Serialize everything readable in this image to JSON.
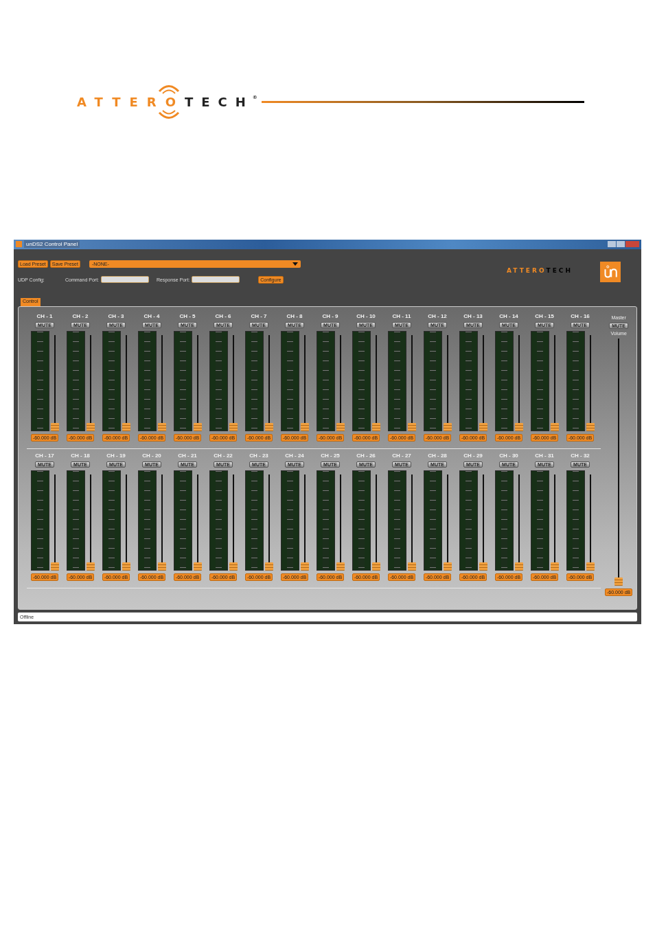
{
  "brand": {
    "first": "ATTERO",
    "second": "TECH",
    "mark": "®"
  },
  "window": {
    "title": "unDS2 Control Panel"
  },
  "toolbar": {
    "buttons": [
      "Load Preset",
      "Save Preset"
    ],
    "preset": "-NONE-"
  },
  "udp": {
    "label": "UDP Config:",
    "command_label": "Command Port:",
    "response_label": "Response Port:",
    "button": "Configure"
  },
  "header_logo": {
    "first": "ATTERO",
    "second": "TECH"
  },
  "tabs": [
    {
      "label": "Control",
      "selected": true
    }
  ],
  "channels": [
    {
      "name": "CH - 1",
      "mute": "MUTE",
      "muted": false,
      "level": 0,
      "reading": "-60.000 dB"
    },
    {
      "name": "CH - 2",
      "mute": "MUTE",
      "muted": false,
      "level": 0,
      "reading": "-60.000 dB"
    },
    {
      "name": "CH - 3",
      "mute": "MUTE",
      "muted": false,
      "level": 0,
      "reading": "-60.000 dB"
    },
    {
      "name": "CH - 4",
      "mute": "MUTE",
      "muted": false,
      "level": 0,
      "reading": "-60.000 dB"
    },
    {
      "name": "CH - 5",
      "mute": "MUTE",
      "muted": false,
      "level": 0,
      "reading": "-60.000 dB"
    },
    {
      "name": "CH - 6",
      "mute": "MUTE",
      "muted": false,
      "level": 0,
      "reading": "-60.000 dB"
    },
    {
      "name": "CH - 7",
      "mute": "MUTE",
      "muted": false,
      "level": 0,
      "reading": "-60.000 dB"
    },
    {
      "name": "CH - 8",
      "mute": "MUTE",
      "muted": false,
      "level": 0,
      "reading": "-60.000 dB"
    },
    {
      "name": "CH - 9",
      "mute": "MUTE",
      "muted": false,
      "level": 0,
      "reading": "-60.000 dB"
    },
    {
      "name": "CH - 10",
      "mute": "MUTE",
      "muted": false,
      "level": 0,
      "reading": "-60.000 dB"
    },
    {
      "name": "CH - 11",
      "mute": "MUTE",
      "muted": false,
      "level": 0,
      "reading": "-60.000 dB"
    },
    {
      "name": "CH - 12",
      "mute": "MUTE",
      "muted": false,
      "level": 0,
      "reading": "-60.000 dB"
    },
    {
      "name": "CH - 13",
      "mute": "MUTE",
      "muted": false,
      "level": 0,
      "reading": "-60.000 dB"
    },
    {
      "name": "CH - 14",
      "mute": "MUTE",
      "muted": false,
      "level": 0,
      "reading": "-60.000 dB"
    },
    {
      "name": "CH - 15",
      "mute": "MUTE",
      "muted": false,
      "level": 0,
      "reading": "-60.000 dB"
    },
    {
      "name": "CH - 16",
      "mute": "MUTE",
      "muted": false,
      "level": 0,
      "reading": "-60.000 dB"
    },
    {
      "name": "CH - 17",
      "mute": "MUTE",
      "muted": false,
      "level": 0,
      "reading": "-60.000 dB"
    },
    {
      "name": "CH - 18",
      "mute": "MUTE",
      "muted": false,
      "level": 0,
      "reading": "-60.000 dB"
    },
    {
      "name": "CH - 19",
      "mute": "MUTE",
      "muted": false,
      "level": 0,
      "reading": "-60.000 dB"
    },
    {
      "name": "CH - 20",
      "mute": "MUTE",
      "muted": false,
      "level": 0,
      "reading": "-60.000 dB"
    },
    {
      "name": "CH - 21",
      "mute": "MUTE",
      "muted": false,
      "level": 0,
      "reading": "-60.000 dB"
    },
    {
      "name": "CH - 22",
      "mute": "MUTE",
      "muted": false,
      "level": 0,
      "reading": "-60.000 dB"
    },
    {
      "name": "CH - 23",
      "mute": "MUTE",
      "muted": false,
      "level": 0,
      "reading": "-60.000 dB"
    },
    {
      "name": "CH - 24",
      "mute": "MUTE",
      "muted": false,
      "level": 0,
      "reading": "-60.000 dB"
    },
    {
      "name": "CH - 25",
      "mute": "MUTE",
      "muted": false,
      "level": 0,
      "reading": "-60.000 dB"
    },
    {
      "name": "CH - 26",
      "mute": "MUTE",
      "muted": false,
      "level": 0,
      "reading": "-60.000 dB"
    },
    {
      "name": "CH - 27",
      "mute": "MUTE",
      "muted": false,
      "level": 0,
      "reading": "-60.000 dB"
    },
    {
      "name": "CH - 28",
      "mute": "MUTE",
      "muted": false,
      "level": 0,
      "reading": "-60.000 dB"
    },
    {
      "name": "CH - 29",
      "mute": "MUTE",
      "muted": false,
      "level": 0,
      "reading": "-60.000 dB"
    },
    {
      "name": "CH - 30",
      "mute": "MUTE",
      "muted": false,
      "level": 0,
      "reading": "-60.000 dB"
    },
    {
      "name": "CH - 31",
      "mute": "MUTE",
      "muted": false,
      "level": 0,
      "reading": "-60.000 dB"
    },
    {
      "name": "CH - 32",
      "mute": "MUTE",
      "muted": false,
      "level": 0,
      "reading": "-60.000 dB"
    }
  ],
  "master": {
    "title": "Master",
    "mute": "MUTE",
    "muted": false,
    "volume_label": "Volume",
    "level": 0,
    "reading": "-60.000 dB"
  },
  "status_bar": {
    "text": "Offline"
  }
}
